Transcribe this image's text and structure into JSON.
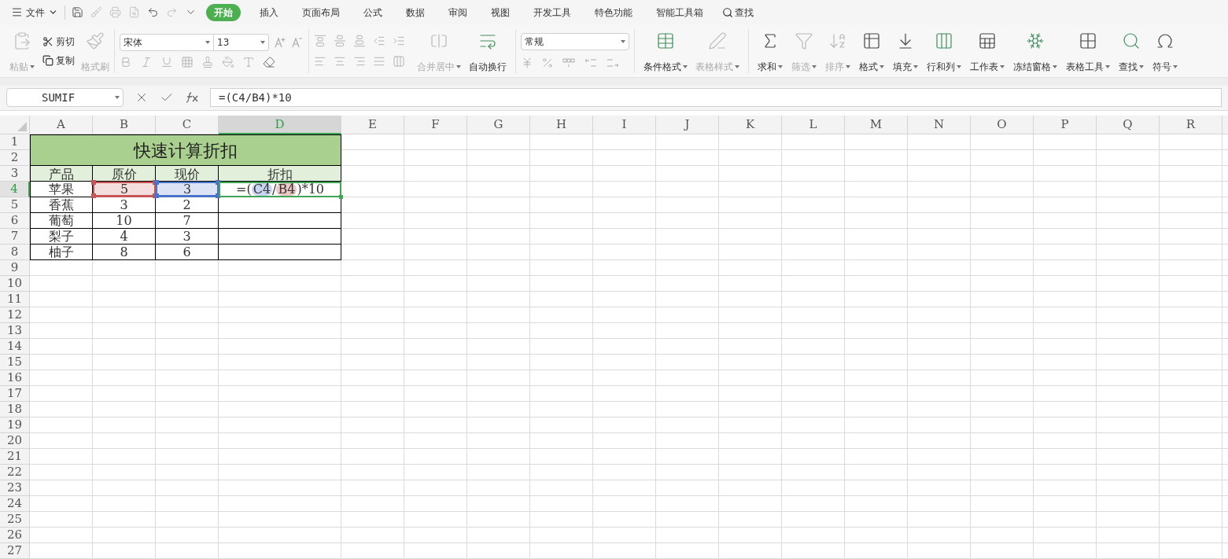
{
  "menu": {
    "file": "文件",
    "quick_access": [
      {
        "kind": "save",
        "disabled": false
      },
      {
        "kind": "format",
        "disabled": true
      },
      {
        "kind": "print",
        "disabled": true
      },
      {
        "kind": "preview",
        "disabled": true
      },
      {
        "kind": "undo",
        "disabled": false
      },
      {
        "kind": "redo",
        "disabled": true
      },
      {
        "kind": "more",
        "disabled": false
      }
    ],
    "tabs": [
      {
        "label": "开始",
        "selected": true
      },
      {
        "label": "插入",
        "selected": false
      },
      {
        "label": "页面布局",
        "selected": false
      },
      {
        "label": "公式",
        "selected": false
      },
      {
        "label": "数据",
        "selected": false
      },
      {
        "label": "审阅",
        "selected": false
      },
      {
        "label": "视图",
        "selected": false
      },
      {
        "label": "开发工具",
        "selected": false
      },
      {
        "label": "特色功能",
        "selected": false
      },
      {
        "label": "智能工具箱",
        "selected": false
      }
    ],
    "search": "查找"
  },
  "clipboard": {
    "paste": {
      "label": "粘贴",
      "disabled": true
    },
    "cut": {
      "label": "剪切",
      "disabled": false
    },
    "copy": {
      "label": "复制",
      "disabled": false
    },
    "painter": {
      "label": "格式刷",
      "disabled": true
    }
  },
  "font": {
    "name": "宋体",
    "size": "13"
  },
  "alignment": [
    {
      "kind": "merge",
      "label": "合并居中",
      "disabled": true,
      "dropdown": true
    },
    {
      "kind": "wrap",
      "label": "自动换行",
      "disabled": false,
      "dropdown": false
    }
  ],
  "number_format": "常规",
  "large_buttons": [
    {
      "kind": "conditional",
      "label": "条件格式",
      "disabled": false,
      "dropdown": true
    },
    {
      "kind": "tablestyle",
      "label": "表格样式",
      "disabled": true,
      "dropdown": true
    },
    {
      "kind": "sum",
      "label": "求和",
      "disabled": false,
      "dropdown": true
    },
    {
      "kind": "filter",
      "label": "筛选",
      "disabled": true,
      "dropdown": true
    },
    {
      "kind": "sort",
      "label": "排序",
      "disabled": true,
      "dropdown": true
    },
    {
      "kind": "format",
      "label": "格式",
      "disabled": false,
      "dropdown": true
    },
    {
      "kind": "fill",
      "label": "填充",
      "disabled": false,
      "dropdown": true
    },
    {
      "kind": "rowcol",
      "label": "行和列",
      "disabled": false,
      "dropdown": true
    },
    {
      "kind": "sheet",
      "label": "工作表",
      "disabled": false,
      "dropdown": true
    },
    {
      "kind": "freeze",
      "label": "冻结窗格",
      "disabled": false,
      "dropdown": true
    },
    {
      "kind": "tools",
      "label": "表格工具",
      "disabled": false,
      "dropdown": true
    },
    {
      "kind": "find",
      "label": "查找",
      "disabled": false,
      "dropdown": true
    },
    {
      "kind": "symbol",
      "label": "符号",
      "disabled": false,
      "dropdown": true
    }
  ],
  "formula_bar": {
    "name_box": "SUMIF",
    "formula": "=(C4/B4)*10"
  },
  "sheet": {
    "columns": [
      {
        "label": "A",
        "selected": false
      },
      {
        "label": "B",
        "selected": false
      },
      {
        "label": "C",
        "selected": false
      },
      {
        "label": "D",
        "selected": true
      },
      {
        "label": "E",
        "selected": false
      },
      {
        "label": "F",
        "selected": false
      },
      {
        "label": "G",
        "selected": false
      },
      {
        "label": "H",
        "selected": false
      },
      {
        "label": "I",
        "selected": false
      },
      {
        "label": "J",
        "selected": false
      },
      {
        "label": "K",
        "selected": false
      },
      {
        "label": "L",
        "selected": false
      },
      {
        "label": "M",
        "selected": false
      },
      {
        "label": "N",
        "selected": false
      },
      {
        "label": "O",
        "selected": false
      },
      {
        "label": "P",
        "selected": false
      },
      {
        "label": "Q",
        "selected": false
      },
      {
        "label": "R",
        "selected": false
      }
    ],
    "rows": [
      {
        "label": "1",
        "selected": false
      },
      {
        "label": "2",
        "selected": false
      },
      {
        "label": "3",
        "selected": false
      },
      {
        "label": "4",
        "selected": true
      },
      {
        "label": "5",
        "selected": false
      },
      {
        "label": "6",
        "selected": false
      },
      {
        "label": "7",
        "selected": false
      },
      {
        "label": "8",
        "selected": false
      },
      {
        "label": "9",
        "selected": false
      },
      {
        "label": "10",
        "selected": false
      },
      {
        "label": "11",
        "selected": false
      },
      {
        "label": "12",
        "selected": false
      },
      {
        "label": "13",
        "selected": false
      },
      {
        "label": "14",
        "selected": false
      },
      {
        "label": "15",
        "selected": false
      },
      {
        "label": "16",
        "selected": false
      },
      {
        "label": "17",
        "selected": false
      },
      {
        "label": "18",
        "selected": false
      },
      {
        "label": "19",
        "selected": false
      },
      {
        "label": "20",
        "selected": false
      },
      {
        "label": "21",
        "selected": false
      },
      {
        "label": "22",
        "selected": false
      },
      {
        "label": "23",
        "selected": false
      },
      {
        "label": "24",
        "selected": false
      },
      {
        "label": "25",
        "selected": false
      },
      {
        "label": "26",
        "selected": false
      },
      {
        "label": "27",
        "selected": false
      }
    ],
    "title": "快速计算折扣",
    "header": [
      "产品",
      "原价",
      "现价",
      "折扣"
    ],
    "table_rows": [
      [
        {
          "kind": "text",
          "text": "苹果"
        },
        {
          "kind": "ref",
          "text": "5",
          "color": "#c65656"
        },
        {
          "kind": "ref",
          "text": "3",
          "color": "#4a72c8"
        },
        {
          "kind": "formula",
          "parts": [
            {
              "text": "=("
            },
            {
              "text": "C4",
              "color": "#c9d5f0"
            },
            {
              "text": "/"
            },
            {
              "text": "B4",
              "color": "#eec7c7"
            },
            {
              "text": ")*10"
            }
          ]
        }
      ],
      [
        {
          "kind": "text",
          "text": "香蕉"
        },
        {
          "kind": "text",
          "text": "3"
        },
        {
          "kind": "text",
          "text": "2"
        },
        {
          "kind": "empty"
        }
      ],
      [
        {
          "kind": "text",
          "text": "葡萄"
        },
        {
          "kind": "text",
          "text": "10"
        },
        {
          "kind": "text",
          "text": "7"
        },
        {
          "kind": "empty"
        }
      ],
      [
        {
          "kind": "text",
          "text": "梨子"
        },
        {
          "kind": "text",
          "text": "4"
        },
        {
          "kind": "text",
          "text": "3"
        },
        {
          "kind": "empty"
        }
      ],
      [
        {
          "kind": "text",
          "text": "柚子"
        },
        {
          "kind": "text",
          "text": "8"
        },
        {
          "kind": "text",
          "text": "6"
        },
        {
          "kind": "empty"
        }
      ]
    ]
  }
}
